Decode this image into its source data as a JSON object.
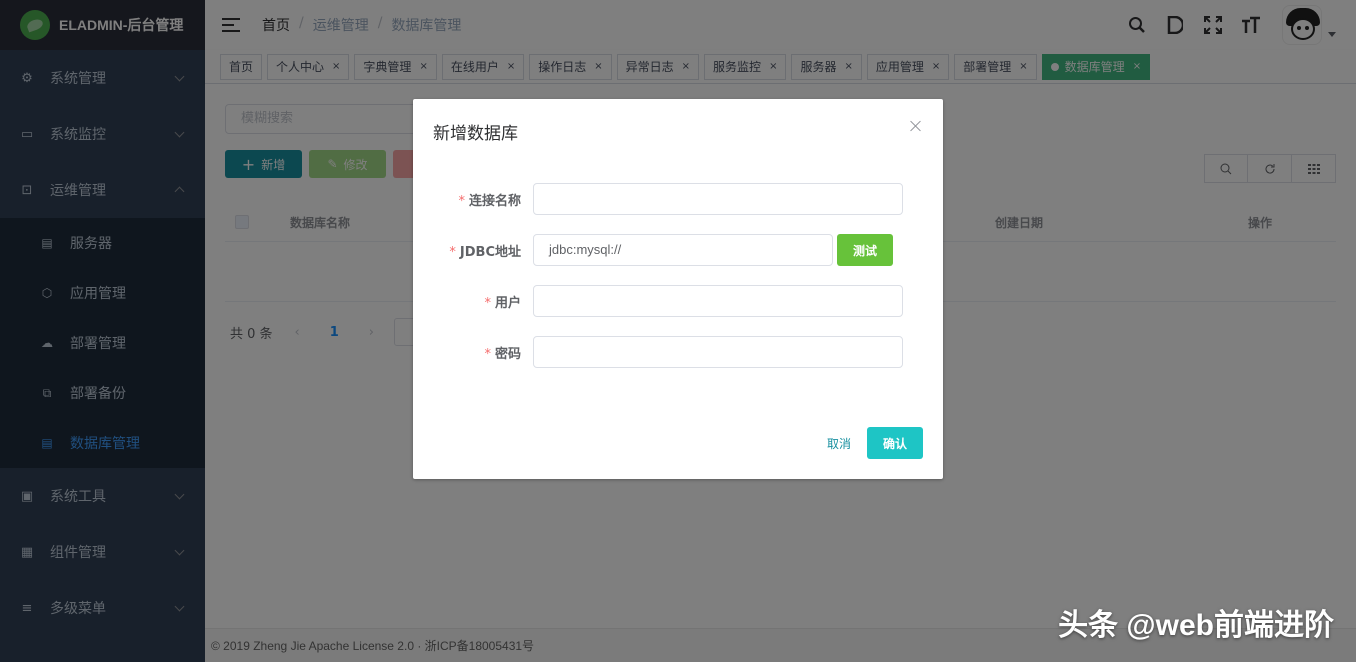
{
  "app": {
    "logo_text": "ELADMIN-后台管理"
  },
  "sidebar": {
    "menus": [
      {
        "label": "系统管理",
        "icon": "gear-icon"
      },
      {
        "label": "系统监控",
        "icon": "monitor-icon"
      },
      {
        "label": "运维管理",
        "icon": "terminal-icon"
      },
      {
        "label": "系统工具",
        "icon": "toolbox-icon"
      },
      {
        "label": "组件管理",
        "icon": "grid-icon"
      },
      {
        "label": "多级菜单",
        "icon": "menu-icon"
      }
    ],
    "ops_submenu": [
      {
        "label": "服务器",
        "icon": "server-icon"
      },
      {
        "label": "应用管理",
        "icon": "cube-icon"
      },
      {
        "label": "部署管理",
        "icon": "cloud-upload-icon"
      },
      {
        "label": "部署备份",
        "icon": "backup-icon"
      },
      {
        "label": "数据库管理",
        "icon": "database-icon",
        "active": true
      }
    ]
  },
  "navbar": {
    "breadcrumb": [
      "首页",
      "运维管理",
      "数据库管理"
    ],
    "separator": "/"
  },
  "tags": [
    {
      "label": "首页",
      "closable": false
    },
    {
      "label": "个人中心",
      "closable": true
    },
    {
      "label": "字典管理",
      "closable": true
    },
    {
      "label": "在线用户",
      "closable": true
    },
    {
      "label": "操作日志",
      "closable": true
    },
    {
      "label": "异常日志",
      "closable": true
    },
    {
      "label": "服务监控",
      "closable": true
    },
    {
      "label": "服务器",
      "closable": true
    },
    {
      "label": "应用管理",
      "closable": true
    },
    {
      "label": "部署管理",
      "closable": true
    },
    {
      "label": "数据库管理",
      "closable": true,
      "active": true
    }
  ],
  "main": {
    "search_placeholder": "模糊搜索",
    "add_label": "新增",
    "edit_label": "修改",
    "table_headers": {
      "name": "数据库名称",
      "created": "创建日期",
      "actions": "操作"
    },
    "pager_total": "共 0 条",
    "pager_current": "1"
  },
  "dialog": {
    "title": "新增数据库",
    "fields": [
      {
        "label": "连接名称",
        "value": "",
        "required": true
      },
      {
        "label": "JDBC地址",
        "value": "jdbc:mysql://",
        "required": true
      },
      {
        "label": "用户",
        "value": "",
        "required": true
      },
      {
        "label": "密码",
        "value": "",
        "required": true
      }
    ],
    "test_label": "测试",
    "cancel_label": "取消",
    "confirm_label": "确认"
  },
  "footer": {
    "text": "© 2019 Zheng Jie Apache License 2.0 · 浙ICP备18005431号"
  },
  "watermark": "头条 @web前端进阶",
  "colors": {
    "sidebar_bg": "#304156",
    "active_tag": "#42b983",
    "primary": "#1890a0",
    "test_btn": "#67c23a",
    "confirm_btn": "#1ec5c5"
  }
}
